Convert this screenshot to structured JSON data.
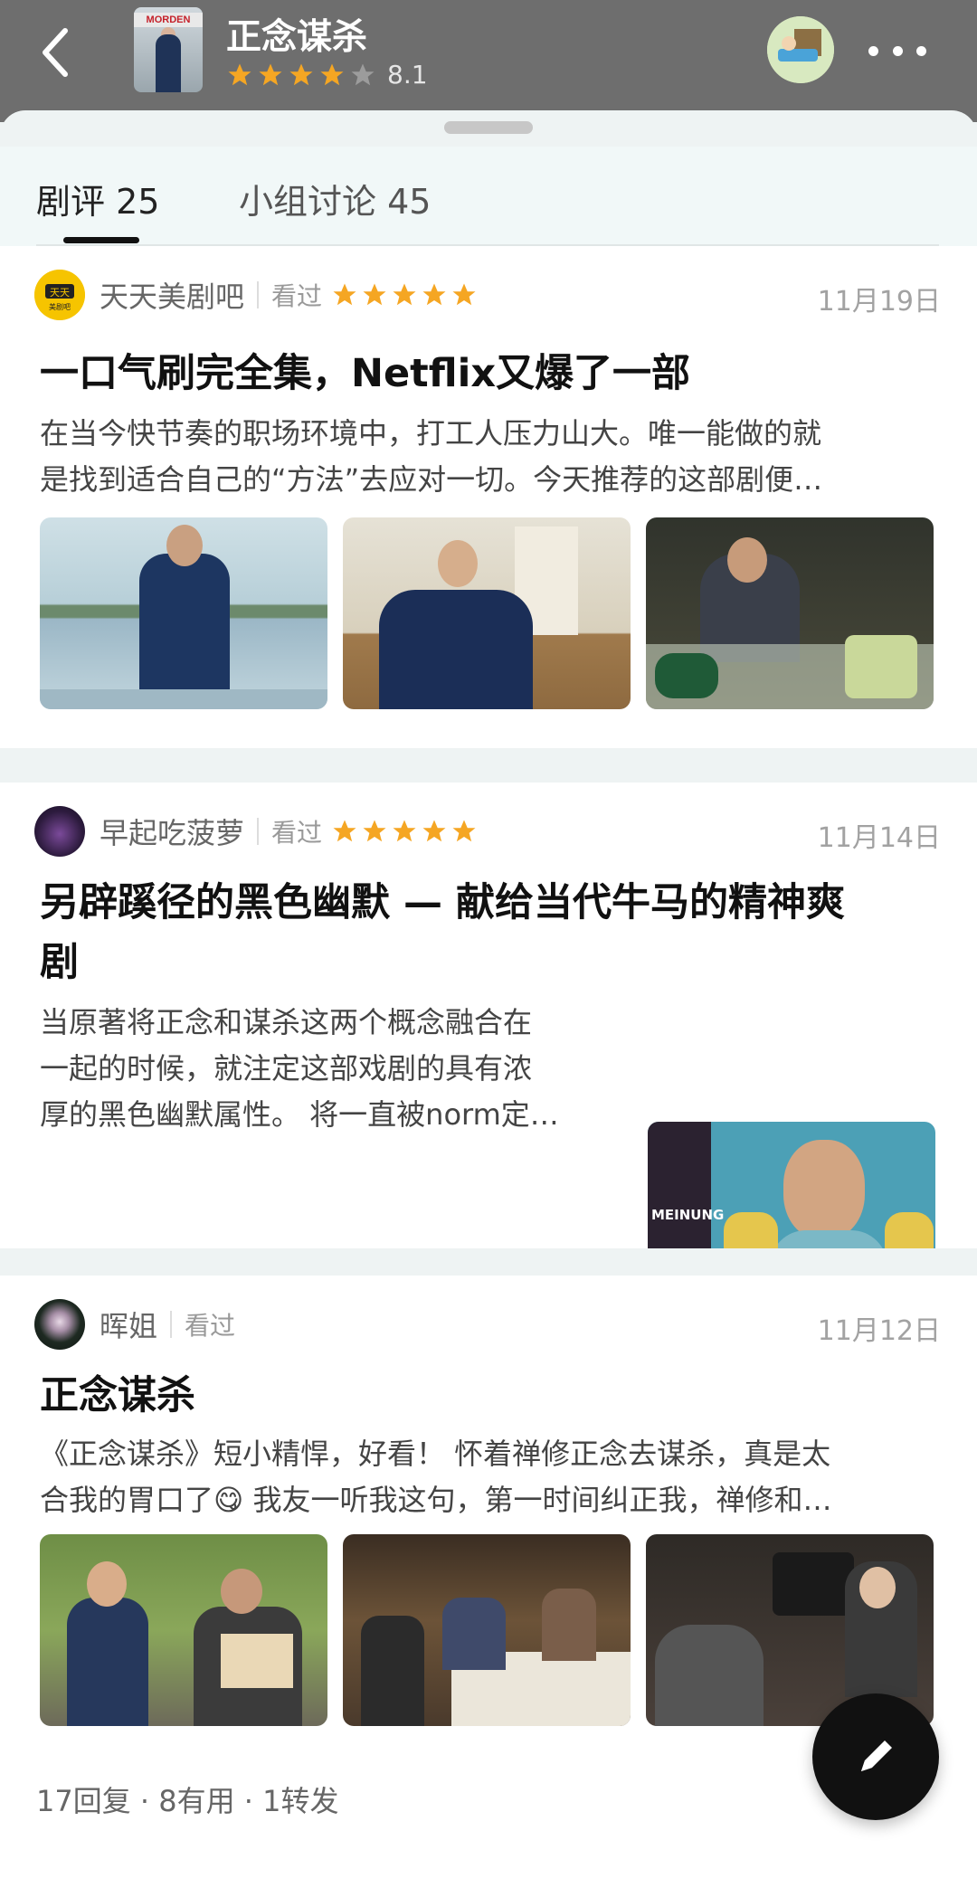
{
  "header": {
    "title": "正念谋杀",
    "rating": "8.1",
    "poster_text": "MORDEN"
  },
  "tabs": [
    {
      "label": "剧评 25"
    },
    {
      "label": "小组讨论 45"
    }
  ],
  "reviews": [
    {
      "author": "天天美剧吧",
      "avatar_text": "天天\n美剧吧",
      "status": "看过",
      "date": "11月19日",
      "headline": "一口气刷完全集，Netflix又爆了一部",
      "excerpt_lines": [
        "在当今快节奏的职场环境中，打工人压力山大。唯一能做的就",
        "是找到适合自己的“方法”去应对一切。今天推荐的这部剧便…"
      ]
    },
    {
      "author": "早起吃菠萝",
      "status": "看过",
      "date": "11月14日",
      "headline_lines": [
        "另辟蹊径的黑色幽默 — 献给当代牛马的精神爽",
        "剧"
      ],
      "excerpt_lines": [
        "当原著将正念和谋杀这两个概念融合在",
        "一起的时候，就注定这部戏剧的具有浓",
        "厚的黑色幽默属性。 将一直被norm定…"
      ],
      "image_text": "MEINUNG"
    },
    {
      "author": "晖姐",
      "status": "看过",
      "date": "11月12日",
      "headline": "正念谋杀",
      "excerpt_lines": [
        "《正念谋杀》短小精悍，好看！ 怀着禅修正念去谋杀，真是太",
        "合我的胃口了😋 我友一听我这句，第一时间纠正我，禅修和…"
      ],
      "stats": "17回复 · 8有用 · 1转发"
    }
  ],
  "colors": {
    "star": "#f5a623",
    "header_bg": "#6e6e6e"
  }
}
